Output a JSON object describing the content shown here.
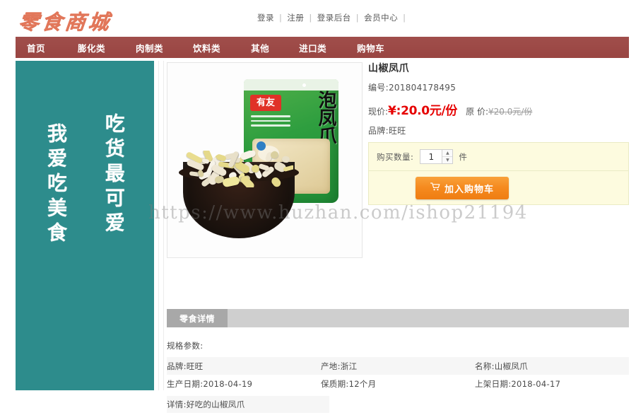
{
  "header": {
    "logo": "零食商城",
    "top_links": [
      "登录",
      "注册",
      "登录后台",
      "会员中心"
    ],
    "separator": "|"
  },
  "nav": {
    "items": [
      {
        "label": "首页",
        "name": "nav-home"
      },
      {
        "label": "膨化类",
        "name": "nav-puffed"
      },
      {
        "label": "肉制类",
        "name": "nav-meat"
      },
      {
        "label": "饮料类",
        "name": "nav-drinks"
      },
      {
        "label": "其他",
        "name": "nav-other"
      },
      {
        "label": "进口类",
        "name": "nav-imported"
      },
      {
        "label": "购物车",
        "name": "nav-cart"
      }
    ]
  },
  "side_banner": {
    "left_text": "我爱吃美食",
    "right_text": "吃货最可爱",
    "background_color": "#2d8c8c"
  },
  "product_image": {
    "alt": "山椒凤爪产品图",
    "package_brand": "有友",
    "package_title": "泡凤爪"
  },
  "watermark": "https://www.huzhan.com/ishop21194",
  "product": {
    "title": "山椒凤爪",
    "code_line": "编号:201804178495",
    "price_label": "现价:",
    "price_now": "¥:20.0元/份",
    "price_old_label": "原 价:",
    "price_old": "¥20.0元/份",
    "brand_line": "品牌:旺旺",
    "origin_line": "产地:浙江"
  },
  "purchase": {
    "qty_label": "购买数量:",
    "qty_value": "1",
    "qty_unit": "件",
    "spinner_up": "▲",
    "spinner_down": "▼",
    "cart_icon": "🛒",
    "cart_button": "加入购物车",
    "accent_color": "#f58a1f"
  },
  "detail": {
    "tab_label": "零食详情",
    "spec_title": "规格参数:",
    "rows": [
      [
        "品牌:旺旺",
        "产地:浙江",
        "名称:山椒凤爪"
      ],
      [
        "生产日期:2018-04-19",
        "保质期:12个月",
        "上架日期:2018-04-17"
      ]
    ],
    "detail_line": "详情:好吃的山椒凤爪"
  }
}
